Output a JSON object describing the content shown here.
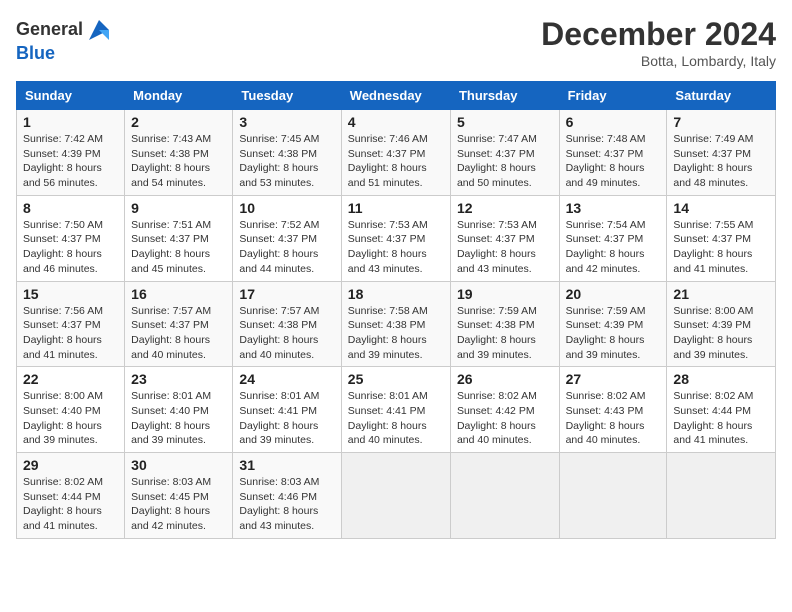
{
  "header": {
    "logo_line1": "General",
    "logo_line2": "Blue",
    "month": "December 2024",
    "location": "Botta, Lombardy, Italy"
  },
  "weekdays": [
    "Sunday",
    "Monday",
    "Tuesday",
    "Wednesday",
    "Thursday",
    "Friday",
    "Saturday"
  ],
  "weeks": [
    [
      {
        "day": "1",
        "sunrise": "Sunrise: 7:42 AM",
        "sunset": "Sunset: 4:39 PM",
        "daylight": "Daylight: 8 hours and 56 minutes."
      },
      {
        "day": "2",
        "sunrise": "Sunrise: 7:43 AM",
        "sunset": "Sunset: 4:38 PM",
        "daylight": "Daylight: 8 hours and 54 minutes."
      },
      {
        "day": "3",
        "sunrise": "Sunrise: 7:45 AM",
        "sunset": "Sunset: 4:38 PM",
        "daylight": "Daylight: 8 hours and 53 minutes."
      },
      {
        "day": "4",
        "sunrise": "Sunrise: 7:46 AM",
        "sunset": "Sunset: 4:37 PM",
        "daylight": "Daylight: 8 hours and 51 minutes."
      },
      {
        "day": "5",
        "sunrise": "Sunrise: 7:47 AM",
        "sunset": "Sunset: 4:37 PM",
        "daylight": "Daylight: 8 hours and 50 minutes."
      },
      {
        "day": "6",
        "sunrise": "Sunrise: 7:48 AM",
        "sunset": "Sunset: 4:37 PM",
        "daylight": "Daylight: 8 hours and 49 minutes."
      },
      {
        "day": "7",
        "sunrise": "Sunrise: 7:49 AM",
        "sunset": "Sunset: 4:37 PM",
        "daylight": "Daylight: 8 hours and 48 minutes."
      }
    ],
    [
      {
        "day": "8",
        "sunrise": "Sunrise: 7:50 AM",
        "sunset": "Sunset: 4:37 PM",
        "daylight": "Daylight: 8 hours and 46 minutes."
      },
      {
        "day": "9",
        "sunrise": "Sunrise: 7:51 AM",
        "sunset": "Sunset: 4:37 PM",
        "daylight": "Daylight: 8 hours and 45 minutes."
      },
      {
        "day": "10",
        "sunrise": "Sunrise: 7:52 AM",
        "sunset": "Sunset: 4:37 PM",
        "daylight": "Daylight: 8 hours and 44 minutes."
      },
      {
        "day": "11",
        "sunrise": "Sunrise: 7:53 AM",
        "sunset": "Sunset: 4:37 PM",
        "daylight": "Daylight: 8 hours and 43 minutes."
      },
      {
        "day": "12",
        "sunrise": "Sunrise: 7:53 AM",
        "sunset": "Sunset: 4:37 PM",
        "daylight": "Daylight: 8 hours and 43 minutes."
      },
      {
        "day": "13",
        "sunrise": "Sunrise: 7:54 AM",
        "sunset": "Sunset: 4:37 PM",
        "daylight": "Daylight: 8 hours and 42 minutes."
      },
      {
        "day": "14",
        "sunrise": "Sunrise: 7:55 AM",
        "sunset": "Sunset: 4:37 PM",
        "daylight": "Daylight: 8 hours and 41 minutes."
      }
    ],
    [
      {
        "day": "15",
        "sunrise": "Sunrise: 7:56 AM",
        "sunset": "Sunset: 4:37 PM",
        "daylight": "Daylight: 8 hours and 41 minutes."
      },
      {
        "day": "16",
        "sunrise": "Sunrise: 7:57 AM",
        "sunset": "Sunset: 4:37 PM",
        "daylight": "Daylight: 8 hours and 40 minutes."
      },
      {
        "day": "17",
        "sunrise": "Sunrise: 7:57 AM",
        "sunset": "Sunset: 4:38 PM",
        "daylight": "Daylight: 8 hours and 40 minutes."
      },
      {
        "day": "18",
        "sunrise": "Sunrise: 7:58 AM",
        "sunset": "Sunset: 4:38 PM",
        "daylight": "Daylight: 8 hours and 39 minutes."
      },
      {
        "day": "19",
        "sunrise": "Sunrise: 7:59 AM",
        "sunset": "Sunset: 4:38 PM",
        "daylight": "Daylight: 8 hours and 39 minutes."
      },
      {
        "day": "20",
        "sunrise": "Sunrise: 7:59 AM",
        "sunset": "Sunset: 4:39 PM",
        "daylight": "Daylight: 8 hours and 39 minutes."
      },
      {
        "day": "21",
        "sunrise": "Sunrise: 8:00 AM",
        "sunset": "Sunset: 4:39 PM",
        "daylight": "Daylight: 8 hours and 39 minutes."
      }
    ],
    [
      {
        "day": "22",
        "sunrise": "Sunrise: 8:00 AM",
        "sunset": "Sunset: 4:40 PM",
        "daylight": "Daylight: 8 hours and 39 minutes."
      },
      {
        "day": "23",
        "sunrise": "Sunrise: 8:01 AM",
        "sunset": "Sunset: 4:40 PM",
        "daylight": "Daylight: 8 hours and 39 minutes."
      },
      {
        "day": "24",
        "sunrise": "Sunrise: 8:01 AM",
        "sunset": "Sunset: 4:41 PM",
        "daylight": "Daylight: 8 hours and 39 minutes."
      },
      {
        "day": "25",
        "sunrise": "Sunrise: 8:01 AM",
        "sunset": "Sunset: 4:41 PM",
        "daylight": "Daylight: 8 hours and 40 minutes."
      },
      {
        "day": "26",
        "sunrise": "Sunrise: 8:02 AM",
        "sunset": "Sunset: 4:42 PM",
        "daylight": "Daylight: 8 hours and 40 minutes."
      },
      {
        "day": "27",
        "sunrise": "Sunrise: 8:02 AM",
        "sunset": "Sunset: 4:43 PM",
        "daylight": "Daylight: 8 hours and 40 minutes."
      },
      {
        "day": "28",
        "sunrise": "Sunrise: 8:02 AM",
        "sunset": "Sunset: 4:44 PM",
        "daylight": "Daylight: 8 hours and 41 minutes."
      }
    ],
    [
      {
        "day": "29",
        "sunrise": "Sunrise: 8:02 AM",
        "sunset": "Sunset: 4:44 PM",
        "daylight": "Daylight: 8 hours and 41 minutes."
      },
      {
        "day": "30",
        "sunrise": "Sunrise: 8:03 AM",
        "sunset": "Sunset: 4:45 PM",
        "daylight": "Daylight: 8 hours and 42 minutes."
      },
      {
        "day": "31",
        "sunrise": "Sunrise: 8:03 AM",
        "sunset": "Sunset: 4:46 PM",
        "daylight": "Daylight: 8 hours and 43 minutes."
      },
      null,
      null,
      null,
      null
    ]
  ]
}
